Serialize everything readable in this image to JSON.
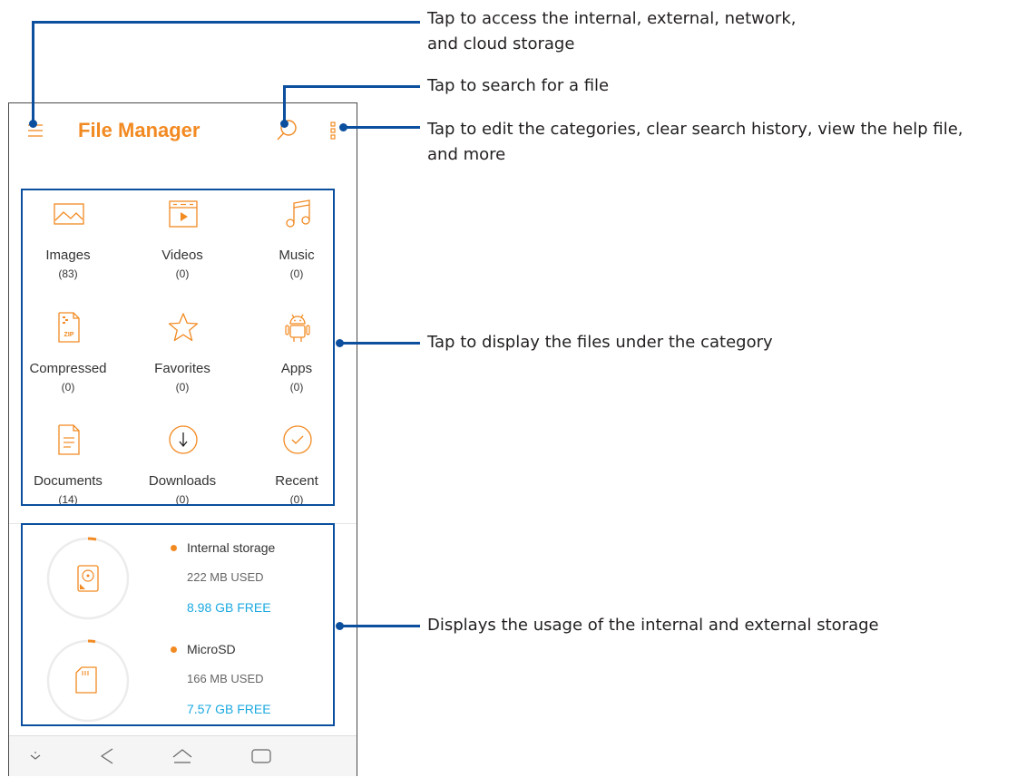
{
  "app": {
    "title": "File Manager",
    "accent_color": "#f28a22",
    "menu_icon": "hamburger-menu-icon",
    "search_icon": "search-icon",
    "more_icon": "more-options-icon"
  },
  "categories": [
    {
      "label": "Images",
      "count": "(83)",
      "icon": "image-icon"
    },
    {
      "label": "Videos",
      "count": "(0)",
      "icon": "video-icon"
    },
    {
      "label": "Music",
      "count": "(0)",
      "icon": "music-note-icon"
    },
    {
      "label": "Compressed",
      "count": "(0)",
      "icon": "zip-file-icon"
    },
    {
      "label": "Favorites",
      "count": "(0)",
      "icon": "star-icon"
    },
    {
      "label": "Apps",
      "count": "(0)",
      "icon": "android-icon"
    },
    {
      "label": "Documents",
      "count": "(14)",
      "icon": "document-icon"
    },
    {
      "label": "Downloads",
      "count": "(0)",
      "icon": "download-icon"
    },
    {
      "label": "Recent",
      "count": "(0)",
      "icon": "check-circle-icon"
    }
  ],
  "storage": [
    {
      "name": "Internal storage",
      "used": "222 MB USED",
      "free": "8.98 GB FREE",
      "icon": "hard-disk-icon"
    },
    {
      "name": "MicroSD",
      "used": "166 MB USED",
      "free": "7.57 GB FREE",
      "icon": "sd-card-icon"
    }
  ],
  "storage_colors": {
    "used_dot": "#f28a22",
    "free_text": "#1aa9e0"
  },
  "navbar": {
    "icons": [
      "notification-pull-icon",
      "back-icon",
      "home-icon",
      "recent-apps-icon"
    ]
  },
  "annotations": {
    "menu_line1": "Tap to access the internal, external, network,",
    "menu_line2": "and cloud storage",
    "search": "Tap to search for a file",
    "more_line1": "Tap to edit the categories, clear search history, view the help file,",
    "more_line2": "and more",
    "categories": "Tap to display the files under the category",
    "storage": "Displays the usage of the internal and external storage",
    "line_color": "#0b4f9e"
  }
}
